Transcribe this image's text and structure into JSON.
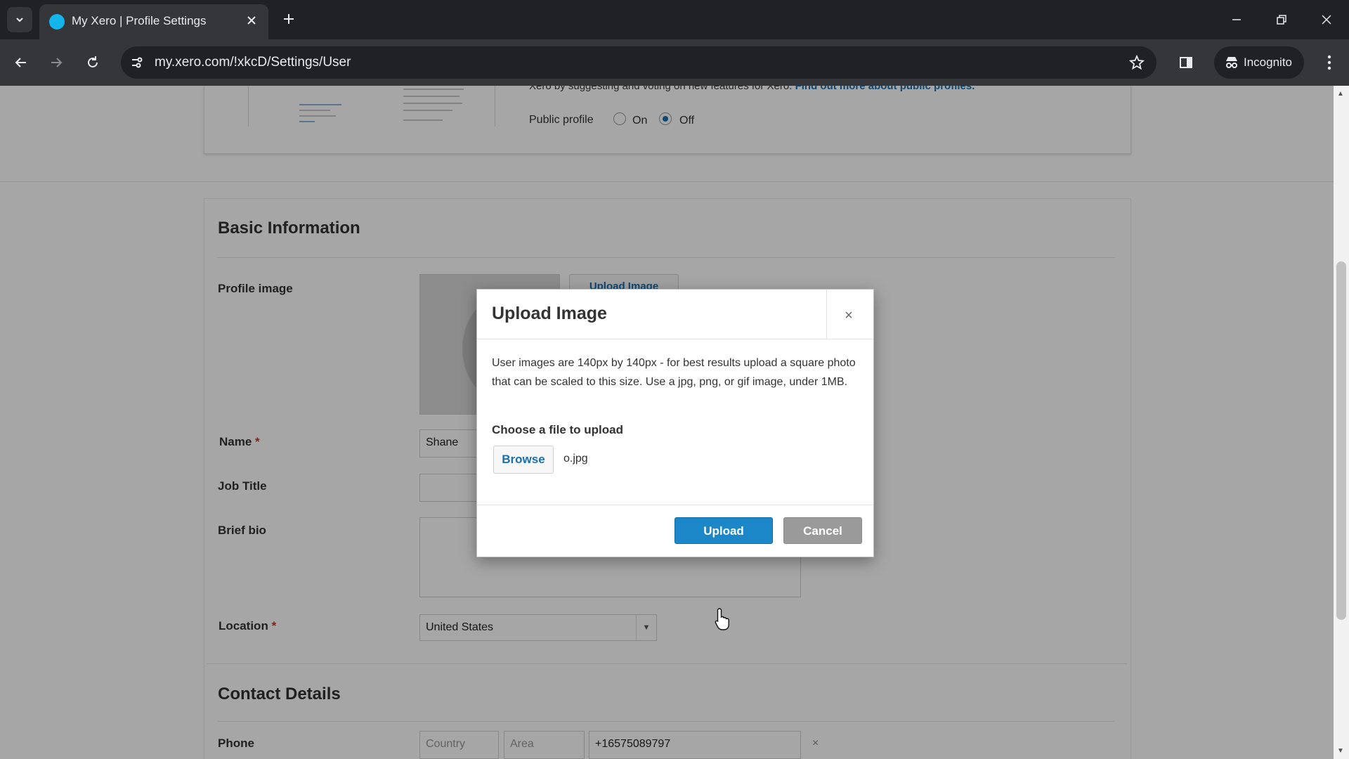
{
  "browser": {
    "tab_title": "My Xero | Profile Settings",
    "url": "my.xero.com/!xkcD/Settings/User",
    "incognito_label": "Incognito"
  },
  "profile_card": {
    "public_text_partial": "Xero by suggesting and voting on new features for Xero.",
    "public_link": "Find out more about public profiles.",
    "public_profile_label": "Public profile",
    "option_on": "On",
    "option_off": "Off",
    "selected": "Off"
  },
  "basic_info": {
    "title": "Basic Information",
    "profile_image_label": "Profile image",
    "upload_image_button": "Upload Image",
    "name_label": "Name",
    "name_value": "Shane",
    "job_title_label": "Job Title",
    "brief_bio_label": "Brief bio",
    "location_label": "Location",
    "location_value": "United States",
    "required_mark": "*"
  },
  "contact": {
    "title": "Contact Details",
    "phone_label": "Phone",
    "country_placeholder": "Country",
    "area_placeholder": "Area",
    "phone_value": "+16575089797",
    "remove_symbol": "×"
  },
  "modal": {
    "title": "Upload Image",
    "close_symbol": "×",
    "description": "User images are 140px by 140px - for best results upload a square photo that can be scaled to this size. Use a jpg, png, or gif image, under 1MB.",
    "choose_label": "Choose a file to upload",
    "browse_button": "Browse",
    "file_name": "o.jpg",
    "upload_button": "Upload",
    "cancel_button": "Cancel"
  },
  "colors": {
    "accent_blue": "#1b87c9",
    "link_blue": "#1b6fae",
    "cancel_gray": "#9a9a9a",
    "chrome_dark": "#202124"
  },
  "icons": [
    "tab-search-icon",
    "xero-favicon-icon",
    "close-icon",
    "plus-icon",
    "minimize-icon",
    "restore-icon",
    "back-arrow-icon",
    "forward-arrow-icon",
    "reload-icon",
    "site-info-icon",
    "star-icon",
    "side-panel-icon",
    "incognito-icon",
    "kebab-menu-icon",
    "pointer-cursor-icon"
  ]
}
